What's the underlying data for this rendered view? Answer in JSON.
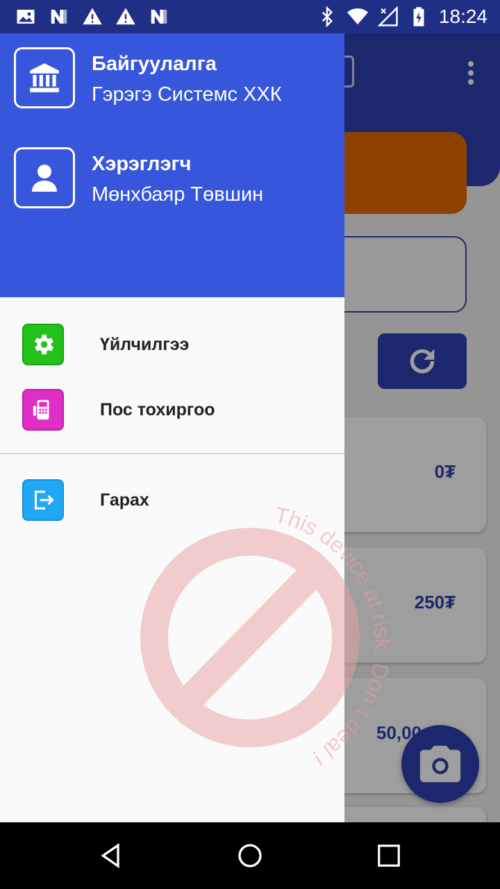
{
  "status_bar": {
    "time": "18:24",
    "left_icons": [
      "image-icon",
      "n-logo-icon",
      "warning-icon",
      "warning-icon",
      "n-logo-icon"
    ],
    "right_icons": [
      "bluetooth-icon",
      "wifi-icon",
      "signal-off-icon",
      "battery-charging-icon"
    ]
  },
  "drawer": {
    "organization": {
      "title": "Байгуулалга",
      "value": "Гэрэгэ Системс ХХК",
      "icon": "bank-icon"
    },
    "user": {
      "title": "Хэрэглэгч",
      "value": "Мөнхбаяр Төвшин",
      "icon": "user-icon"
    },
    "menu": [
      {
        "label": "Үйлчилгээ",
        "icon": "gear-icon",
        "color": "#22c21a"
      },
      {
        "label": "Пос тохиргоо",
        "icon": "pos-terminal-icon",
        "color": "#e02fc7"
      },
      {
        "label": "Гарах",
        "icon": "logout-icon",
        "color": "#20a8f5"
      }
    ]
  },
  "background_app": {
    "amounts": [
      "0₮",
      "250₮",
      "50,00"
    ],
    "accent": "#2f3fb0",
    "orange": "#e56b00"
  },
  "watermark": {
    "text": "This device at risk. Don`t deal !"
  },
  "colors": {
    "drawer_header": "#3656dc",
    "status_bar": "#1f2f85"
  }
}
